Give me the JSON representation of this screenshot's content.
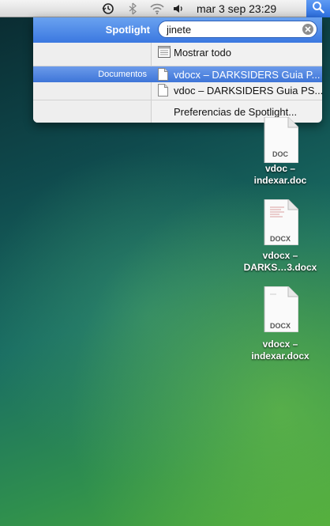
{
  "menubar": {
    "clock": "mar 3 sep  23:29",
    "icons": [
      "time-machine-icon",
      "bluetooth-icon",
      "wifi-icon",
      "volume-icon",
      "spotlight-icon"
    ]
  },
  "spotlight": {
    "title": "Spotlight",
    "query": "jinete",
    "show_all": "Mostrar todo",
    "section": "Documentos",
    "results": [
      "vdocx – DARKSIDERS Guia P...",
      "vdoc – DARKSIDERS Guia PS..."
    ],
    "preferences": "Preferencias de Spotlight..."
  },
  "desktop": {
    "files": [
      {
        "line1": "vdoc –",
        "line2": "indexar.doc",
        "badge": "DOC"
      },
      {
        "line1": "vdocx –",
        "line2": "DARKS…3.docx",
        "badge": "DOCX"
      },
      {
        "line1": "vdocx –",
        "line2": "indexar.docx",
        "badge": "DOCX"
      }
    ]
  },
  "colors": {
    "accent": "#3b78e0",
    "selection": "#4a7fdb"
  }
}
